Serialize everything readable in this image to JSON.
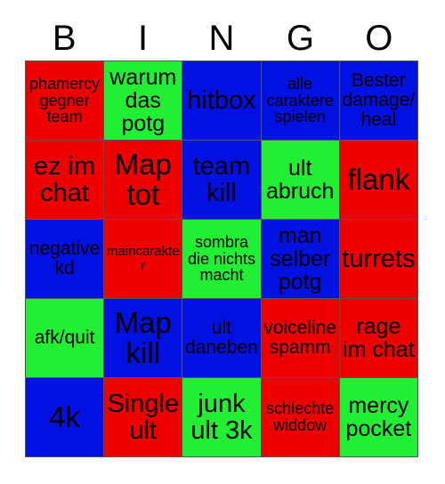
{
  "card": {
    "title_letters": [
      "B",
      "I",
      "N",
      "G",
      "O"
    ],
    "colors": {
      "red": "#ef0000",
      "green": "#22ee33",
      "blue": "#0011e2",
      "text": "#000000",
      "gridline": "#555555",
      "background": "#ffffff"
    },
    "columns": 5,
    "rows": 5,
    "cells": [
      {
        "text": "phamercy gegner team",
        "color": "red",
        "size": "sm"
      },
      {
        "text": "warum das potg",
        "color": "green",
        "size": "lg"
      },
      {
        "text": "hitbox",
        "color": "blue",
        "size": "xl"
      },
      {
        "text": "alle caraktere spielen",
        "color": "blue",
        "size": "sm"
      },
      {
        "text": "Bester damage/ heal",
        "color": "blue",
        "size": "md"
      },
      {
        "text": "ez im chat",
        "color": "red",
        "size": "xl"
      },
      {
        "text": "Map tot",
        "color": "red",
        "size": "xxl"
      },
      {
        "text": "team kill",
        "color": "blue",
        "size": "xl"
      },
      {
        "text": "ult abruch",
        "color": "green",
        "size": "lg"
      },
      {
        "text": "flank",
        "color": "red",
        "size": "xxl"
      },
      {
        "text": "negative kd",
        "color": "blue",
        "size": "md"
      },
      {
        "text": "maincarakter",
        "color": "red",
        "size": "xs"
      },
      {
        "text": "sombra die nichts macht",
        "color": "green",
        "size": "sm"
      },
      {
        "text": "man selber potg",
        "color": "blue",
        "size": "lg"
      },
      {
        "text": "turrets",
        "color": "red",
        "size": "xl"
      },
      {
        "text": "afk/quit",
        "color": "green",
        "size": "md"
      },
      {
        "text": "Map kill",
        "color": "blue",
        "size": "xxl"
      },
      {
        "text": "ult daneben",
        "color": "blue",
        "size": "md"
      },
      {
        "text": "voiceline spamm",
        "color": "red",
        "size": "md"
      },
      {
        "text": "rage im chat",
        "color": "red",
        "size": "lg"
      },
      {
        "text": "4k",
        "color": "blue",
        "size": "xxl"
      },
      {
        "text": "Single ult",
        "color": "red",
        "size": "xl"
      },
      {
        "text": "junk ult 3k",
        "color": "green",
        "size": "xl"
      },
      {
        "text": "schlechte widdow",
        "color": "red",
        "size": "sm"
      },
      {
        "text": "mercy pocket",
        "color": "green",
        "size": "lg"
      }
    ]
  }
}
